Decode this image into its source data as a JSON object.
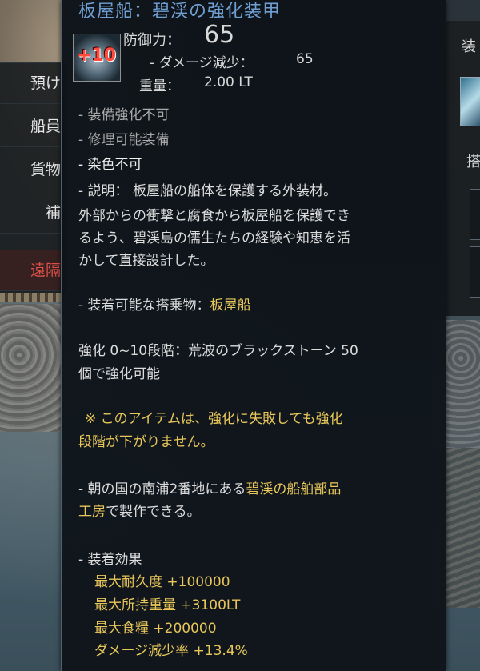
{
  "left_panel": {
    "items": [
      "預け",
      "船員",
      "貨物",
      "補",
      "遠隔"
    ]
  },
  "right_panel": {
    "top_text": "装",
    "mid_text": "搭"
  },
  "tooltip": {
    "title": "板屋船：碧渓の強化装甲",
    "icon_badge": "+10",
    "defense_label": "防御力：",
    "defense_value": "65",
    "damage_reduction_label": "- ダメージ減少：",
    "damage_reduction_value": "65",
    "weight_label": "重量：",
    "weight_value": "2.00 LT",
    "flags": [
      "- 装備強化不可",
      "- 修理可能装備",
      "- 染色不可"
    ],
    "description_lines": [
      "- 説明： 板屋船の船体を保護する外装材。",
      "外部からの衝撃と腐食から板屋船を保護でき",
      "るよう、碧渓島の儒生たちの経験や知恵を活",
      "かして直接設計した。"
    ],
    "mountable_prefix": "- 装着可能な搭乗物：",
    "mountable_value": "板屋船",
    "enhance_lines": [
      "強化 0~10段階：荒波のブラックストーン 50",
      "個で強化可能"
    ],
    "notice_lines": [
      "※ このアイテムは、強化に失敗しても強化",
      "段階が下がりません。"
    ],
    "craft_line1_prefix": "- 朝の国の南浦2番地にある",
    "craft_line1_highlight": "碧渓の船舶部品",
    "craft_line2_highlight": "工房",
    "craft_line2_suffix": "で製作できる。",
    "effects_header": "- 装着効果",
    "effects": [
      "最大耐久度 +100000",
      "最大所持重量 +3100LT",
      "最大食糧 +200000",
      "ダメージ減少率 +13.4%"
    ]
  },
  "colors": {
    "title": "#6f9fd3",
    "gold": "#e8c65a",
    "red_text": "#e0514a"
  }
}
